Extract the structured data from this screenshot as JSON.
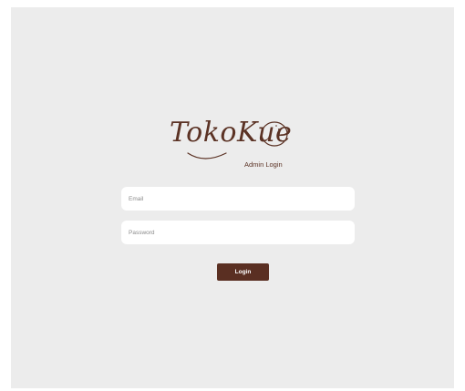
{
  "brand": {
    "logo_text": "TokoKue",
    "subtitle": "Admin Login",
    "color": "#5b3224"
  },
  "form": {
    "email_placeholder": "Email",
    "password_placeholder": "Password",
    "login_label": "Login",
    "button_color": "#5a2f22"
  },
  "icons": {
    "logo_mark": "cookie-icon"
  }
}
